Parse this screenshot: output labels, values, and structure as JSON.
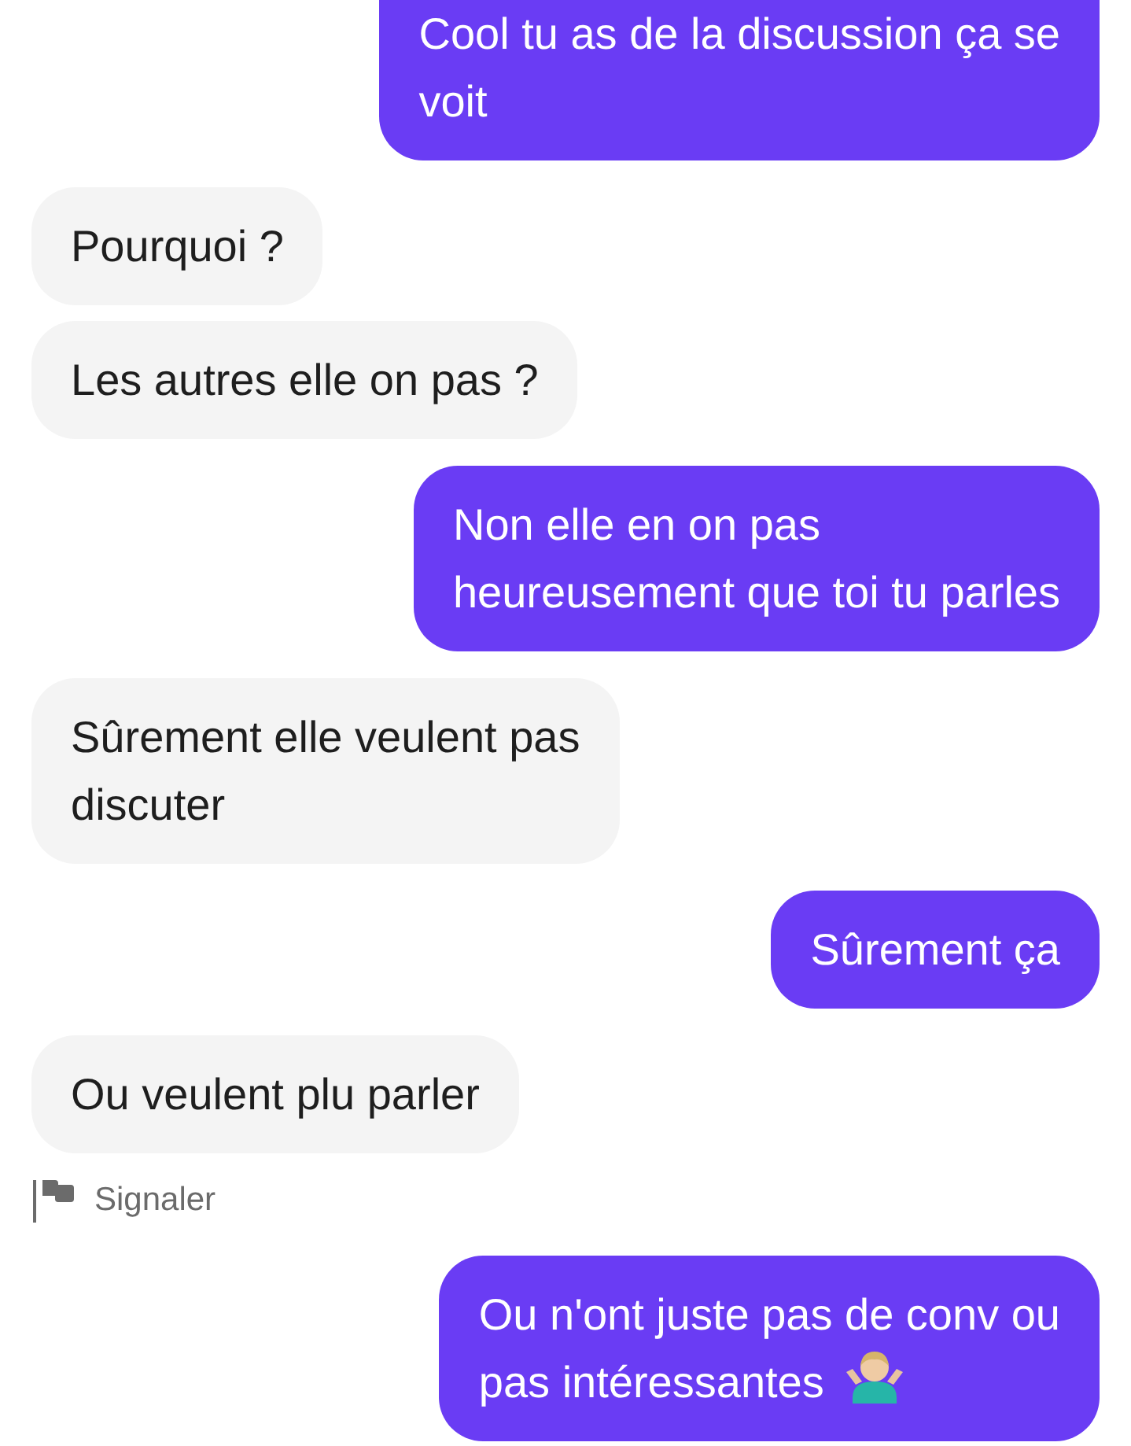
{
  "messages": [
    {
      "kind": "sent",
      "text": "Cool tu as de la discussion ça se\nvoit",
      "cut_top": true
    },
    {
      "kind": "received",
      "text": "Pourquoi ?"
    },
    {
      "kind": "received",
      "text": "Les autres elle on pas ?"
    },
    {
      "kind": "sent",
      "text": "Non elle en on pas\nheureusement que toi tu parles"
    },
    {
      "kind": "received",
      "text": "Sûrement elle veulent pas\ndiscuter"
    },
    {
      "kind": "sent",
      "text": "Sûrement ça"
    },
    {
      "kind": "received",
      "text": "Ou veulent plu parler"
    },
    {
      "kind": "report",
      "text": "Signaler"
    },
    {
      "kind": "sent",
      "text": "Ou n'ont juste pas de conv ou\npas intéressantes",
      "emoji": {
        "kind": "shrug"
      }
    }
  ]
}
